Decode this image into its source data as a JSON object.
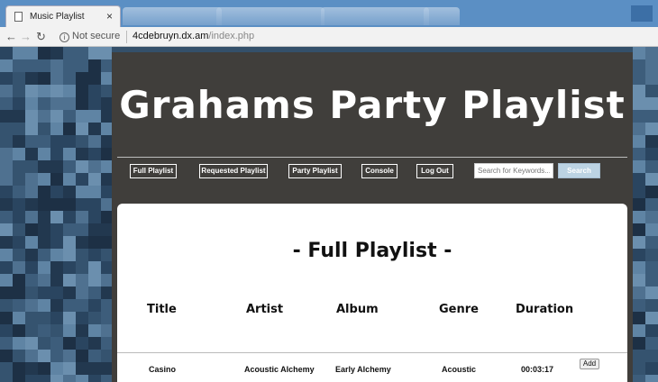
{
  "browser": {
    "tab_title": "Music Playlist",
    "tab_close": "×",
    "secure_label": "Not secure",
    "url_host": "4cdebruyn.dx.am",
    "url_path": "/index.php"
  },
  "site": {
    "title": "Grahams Party Playlist",
    "nav": [
      "Full Playlist",
      "Requested Playlist",
      "Party Playlist",
      "Console",
      "Log Out"
    ],
    "search_placeholder": "Search for Keywords...",
    "search_label": "Search"
  },
  "playlist": {
    "title": "- Full Playlist -",
    "columns": [
      "Title",
      "Artist",
      "Album",
      "Genre",
      "Duration"
    ],
    "rows": [
      {
        "title": "Casino",
        "artist": "Acoustic Alchemy",
        "album": "Early Alchemy",
        "genre": "Acoustic",
        "duration": "00:03:17",
        "action": "Add"
      }
    ]
  },
  "colors": {
    "panel": "#403e3b",
    "background": "#34506a",
    "search_button": "#bcd3e3"
  }
}
